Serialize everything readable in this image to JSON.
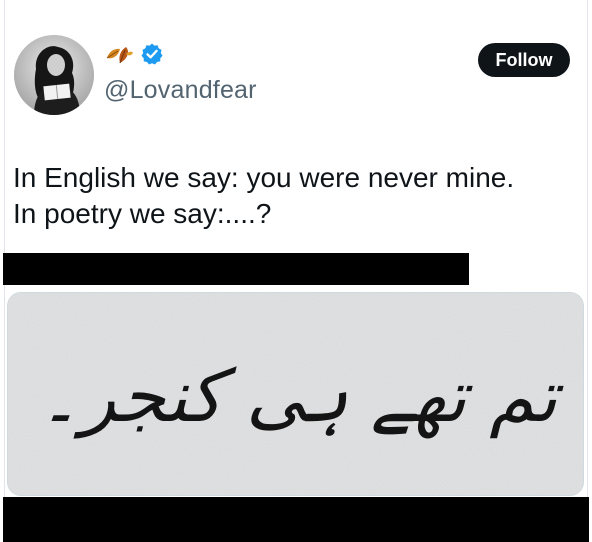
{
  "post": {
    "handle": "@Lovandfear",
    "follow_label": "Follow",
    "text_lines": [
      "In English we say: you were never mine.",
      "In poetry we say:....?"
    ],
    "image_text": "تم تھے ہی کنجر۔"
  },
  "icons": {
    "name_badge": "autumn-leaves-icon",
    "verified": "verified-badge-icon"
  },
  "colors": {
    "follow_bg": "#0f1419",
    "verified": "#1d9bf0",
    "handle": "#536471",
    "text": "#0f1419"
  }
}
